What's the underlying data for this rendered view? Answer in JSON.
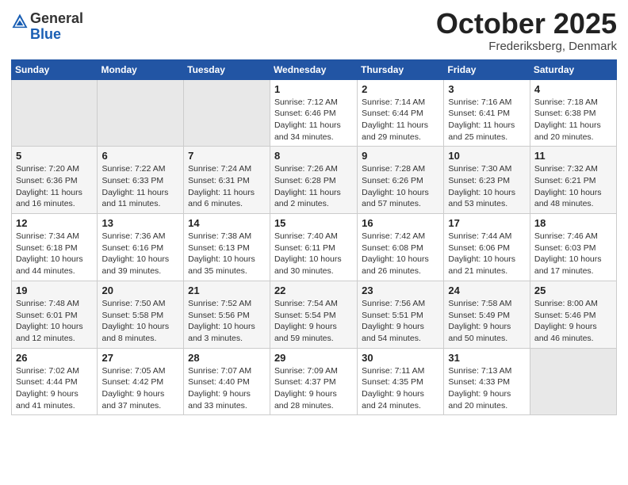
{
  "header": {
    "logo_general": "General",
    "logo_blue": "Blue",
    "month_title": "October 2025",
    "location": "Frederiksberg, Denmark"
  },
  "weekdays": [
    "Sunday",
    "Monday",
    "Tuesday",
    "Wednesday",
    "Thursday",
    "Friday",
    "Saturday"
  ],
  "weeks": [
    [
      {
        "day": "",
        "info": ""
      },
      {
        "day": "",
        "info": ""
      },
      {
        "day": "",
        "info": ""
      },
      {
        "day": "1",
        "info": "Sunrise: 7:12 AM\nSunset: 6:46 PM\nDaylight: 11 hours\nand 34 minutes."
      },
      {
        "day": "2",
        "info": "Sunrise: 7:14 AM\nSunset: 6:44 PM\nDaylight: 11 hours\nand 29 minutes."
      },
      {
        "day": "3",
        "info": "Sunrise: 7:16 AM\nSunset: 6:41 PM\nDaylight: 11 hours\nand 25 minutes."
      },
      {
        "day": "4",
        "info": "Sunrise: 7:18 AM\nSunset: 6:38 PM\nDaylight: 11 hours\nand 20 minutes."
      }
    ],
    [
      {
        "day": "5",
        "info": "Sunrise: 7:20 AM\nSunset: 6:36 PM\nDaylight: 11 hours\nand 16 minutes."
      },
      {
        "day": "6",
        "info": "Sunrise: 7:22 AM\nSunset: 6:33 PM\nDaylight: 11 hours\nand 11 minutes."
      },
      {
        "day": "7",
        "info": "Sunrise: 7:24 AM\nSunset: 6:31 PM\nDaylight: 11 hours\nand 6 minutes."
      },
      {
        "day": "8",
        "info": "Sunrise: 7:26 AM\nSunset: 6:28 PM\nDaylight: 11 hours\nand 2 minutes."
      },
      {
        "day": "9",
        "info": "Sunrise: 7:28 AM\nSunset: 6:26 PM\nDaylight: 10 hours\nand 57 minutes."
      },
      {
        "day": "10",
        "info": "Sunrise: 7:30 AM\nSunset: 6:23 PM\nDaylight: 10 hours\nand 53 minutes."
      },
      {
        "day": "11",
        "info": "Sunrise: 7:32 AM\nSunset: 6:21 PM\nDaylight: 10 hours\nand 48 minutes."
      }
    ],
    [
      {
        "day": "12",
        "info": "Sunrise: 7:34 AM\nSunset: 6:18 PM\nDaylight: 10 hours\nand 44 minutes."
      },
      {
        "day": "13",
        "info": "Sunrise: 7:36 AM\nSunset: 6:16 PM\nDaylight: 10 hours\nand 39 minutes."
      },
      {
        "day": "14",
        "info": "Sunrise: 7:38 AM\nSunset: 6:13 PM\nDaylight: 10 hours\nand 35 minutes."
      },
      {
        "day": "15",
        "info": "Sunrise: 7:40 AM\nSunset: 6:11 PM\nDaylight: 10 hours\nand 30 minutes."
      },
      {
        "day": "16",
        "info": "Sunrise: 7:42 AM\nSunset: 6:08 PM\nDaylight: 10 hours\nand 26 minutes."
      },
      {
        "day": "17",
        "info": "Sunrise: 7:44 AM\nSunset: 6:06 PM\nDaylight: 10 hours\nand 21 minutes."
      },
      {
        "day": "18",
        "info": "Sunrise: 7:46 AM\nSunset: 6:03 PM\nDaylight: 10 hours\nand 17 minutes."
      }
    ],
    [
      {
        "day": "19",
        "info": "Sunrise: 7:48 AM\nSunset: 6:01 PM\nDaylight: 10 hours\nand 12 minutes."
      },
      {
        "day": "20",
        "info": "Sunrise: 7:50 AM\nSunset: 5:58 PM\nDaylight: 10 hours\nand 8 minutes."
      },
      {
        "day": "21",
        "info": "Sunrise: 7:52 AM\nSunset: 5:56 PM\nDaylight: 10 hours\nand 3 minutes."
      },
      {
        "day": "22",
        "info": "Sunrise: 7:54 AM\nSunset: 5:54 PM\nDaylight: 9 hours\nand 59 minutes."
      },
      {
        "day": "23",
        "info": "Sunrise: 7:56 AM\nSunset: 5:51 PM\nDaylight: 9 hours\nand 54 minutes."
      },
      {
        "day": "24",
        "info": "Sunrise: 7:58 AM\nSunset: 5:49 PM\nDaylight: 9 hours\nand 50 minutes."
      },
      {
        "day": "25",
        "info": "Sunrise: 8:00 AM\nSunset: 5:46 PM\nDaylight: 9 hours\nand 46 minutes."
      }
    ],
    [
      {
        "day": "26",
        "info": "Sunrise: 7:02 AM\nSunset: 4:44 PM\nDaylight: 9 hours\nand 41 minutes."
      },
      {
        "day": "27",
        "info": "Sunrise: 7:05 AM\nSunset: 4:42 PM\nDaylight: 9 hours\nand 37 minutes."
      },
      {
        "day": "28",
        "info": "Sunrise: 7:07 AM\nSunset: 4:40 PM\nDaylight: 9 hours\nand 33 minutes."
      },
      {
        "day": "29",
        "info": "Sunrise: 7:09 AM\nSunset: 4:37 PM\nDaylight: 9 hours\nand 28 minutes."
      },
      {
        "day": "30",
        "info": "Sunrise: 7:11 AM\nSunset: 4:35 PM\nDaylight: 9 hours\nand 24 minutes."
      },
      {
        "day": "31",
        "info": "Sunrise: 7:13 AM\nSunset: 4:33 PM\nDaylight: 9 hours\nand 20 minutes."
      },
      {
        "day": "",
        "info": ""
      }
    ]
  ]
}
